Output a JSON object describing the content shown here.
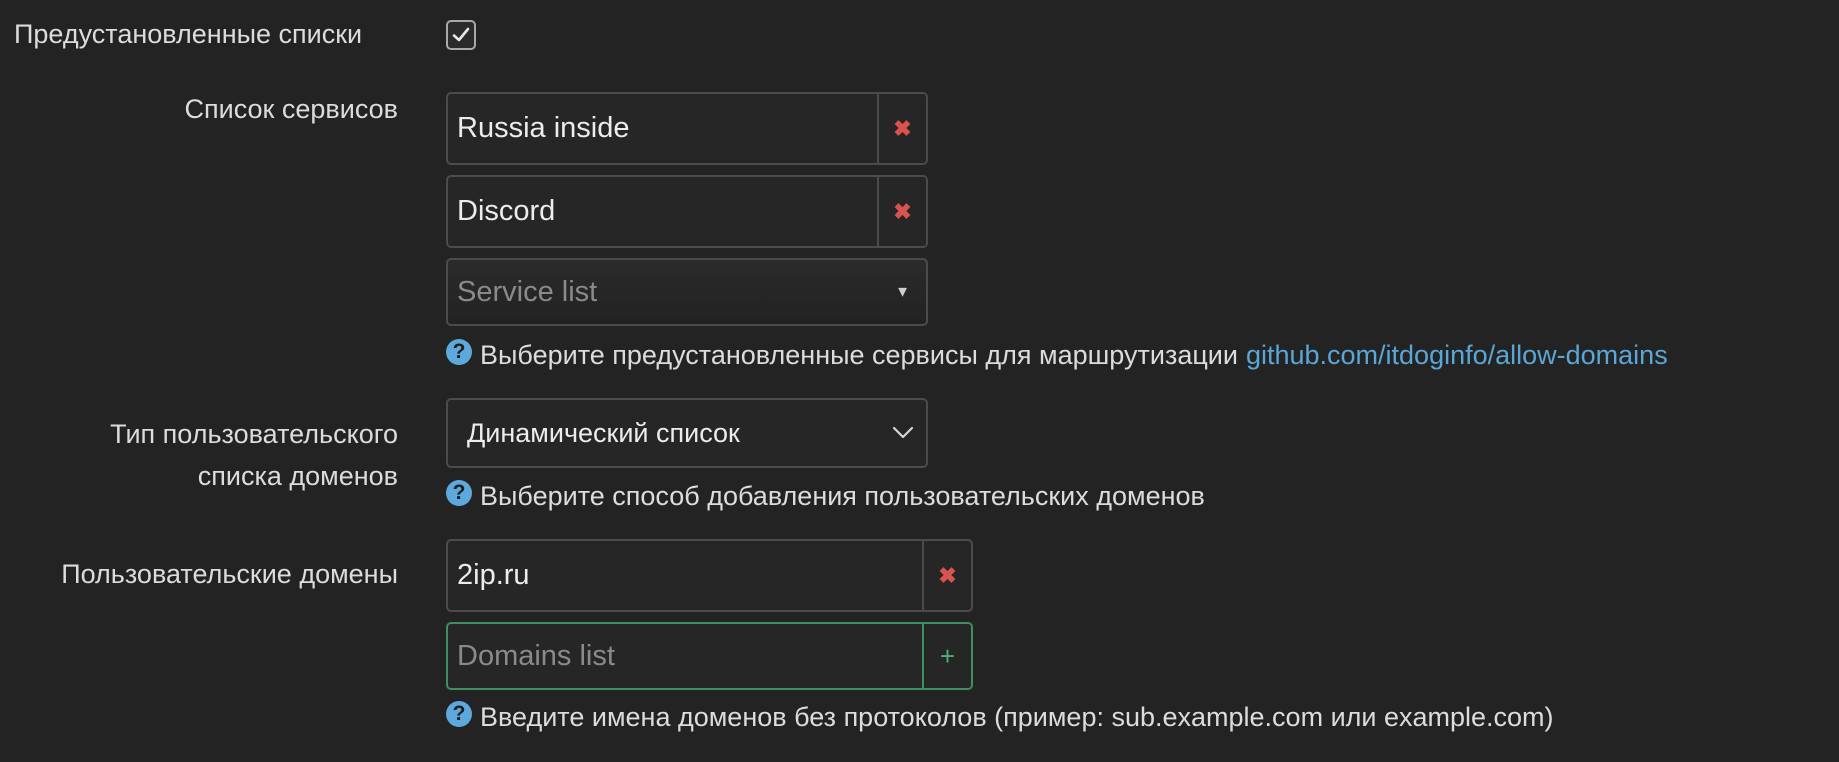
{
  "preinstalled": {
    "label": "Предустановленные списки",
    "checked": true
  },
  "services": {
    "label": "Список сервисов",
    "items": [
      {
        "value": "Russia inside"
      },
      {
        "value": "Discord"
      }
    ],
    "placeholder": "Service list",
    "help_text": "Выберите предустановленные сервисы для маршрутизации",
    "help_link": "github.com/itdoginfo/allow-domains"
  },
  "domain_list_type": {
    "label_line1": "Тип пользовательского",
    "label_line2": "списка доменов",
    "selected": "Динамический список",
    "help_text": "Выберите способ добавления пользовательских доменов"
  },
  "custom_domains": {
    "label": "Пользовательские домены",
    "items": [
      {
        "value": "2ip.ru"
      }
    ],
    "placeholder": "Domains list",
    "help_text": "Введите имена доменов без протоколов (пример: sub.example.com или example.com)"
  },
  "icons": {
    "remove": "remove-icon",
    "add": "plus-icon",
    "help": "question-circle-icon",
    "check": "checkmark-icon",
    "dropdown": "chevron-down-icon"
  },
  "colors": {
    "background": "#232323",
    "remove": "#d9534f",
    "add": "#4caf7d",
    "link": "#5aa6d6",
    "help_icon": "#5da9dd"
  }
}
